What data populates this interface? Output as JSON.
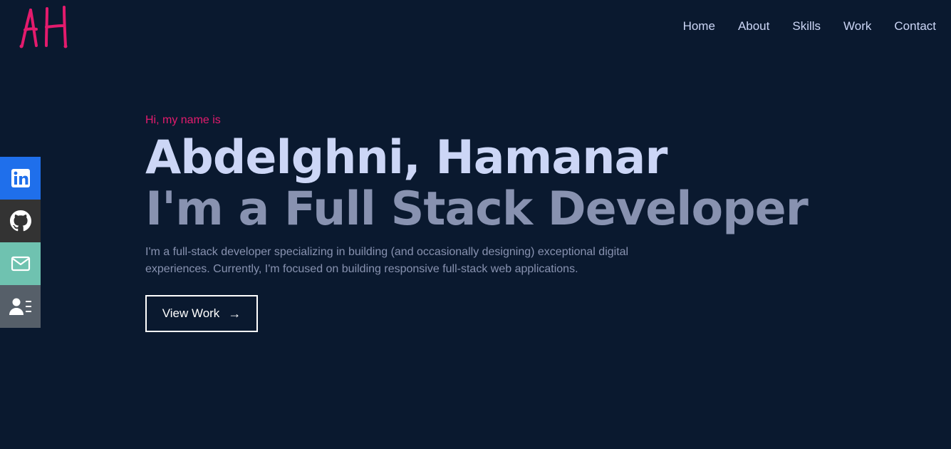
{
  "header": {
    "logo_text": "AH",
    "nav": [
      {
        "label": "Home"
      },
      {
        "label": "About"
      },
      {
        "label": "Skills"
      },
      {
        "label": "Work"
      },
      {
        "label": "Contact"
      }
    ]
  },
  "social": [
    {
      "icon": "linkedin-icon",
      "color": "#1f6feb"
    },
    {
      "icon": "github-icon",
      "color": "#333333"
    },
    {
      "icon": "mail-icon",
      "color": "#6fc2b0"
    },
    {
      "icon": "resume-icon",
      "color": "#565f69"
    }
  ],
  "hero": {
    "greeting": "Hi, my name is",
    "name": "Abdelghni, Hamanar",
    "role": "I'm a Full Stack Developer",
    "bio": "I'm a full-stack developer specializing in building (and occasionally designing) exceptional digital experiences. Currently, I'm focused on building responsive full-stack web applications.",
    "cta_label": "View Work",
    "cta_arrow": "→"
  },
  "colors": {
    "background": "#0a192f",
    "accent": "#e31b6d",
    "heading": "#ccd6f6",
    "muted": "#8892b0"
  }
}
